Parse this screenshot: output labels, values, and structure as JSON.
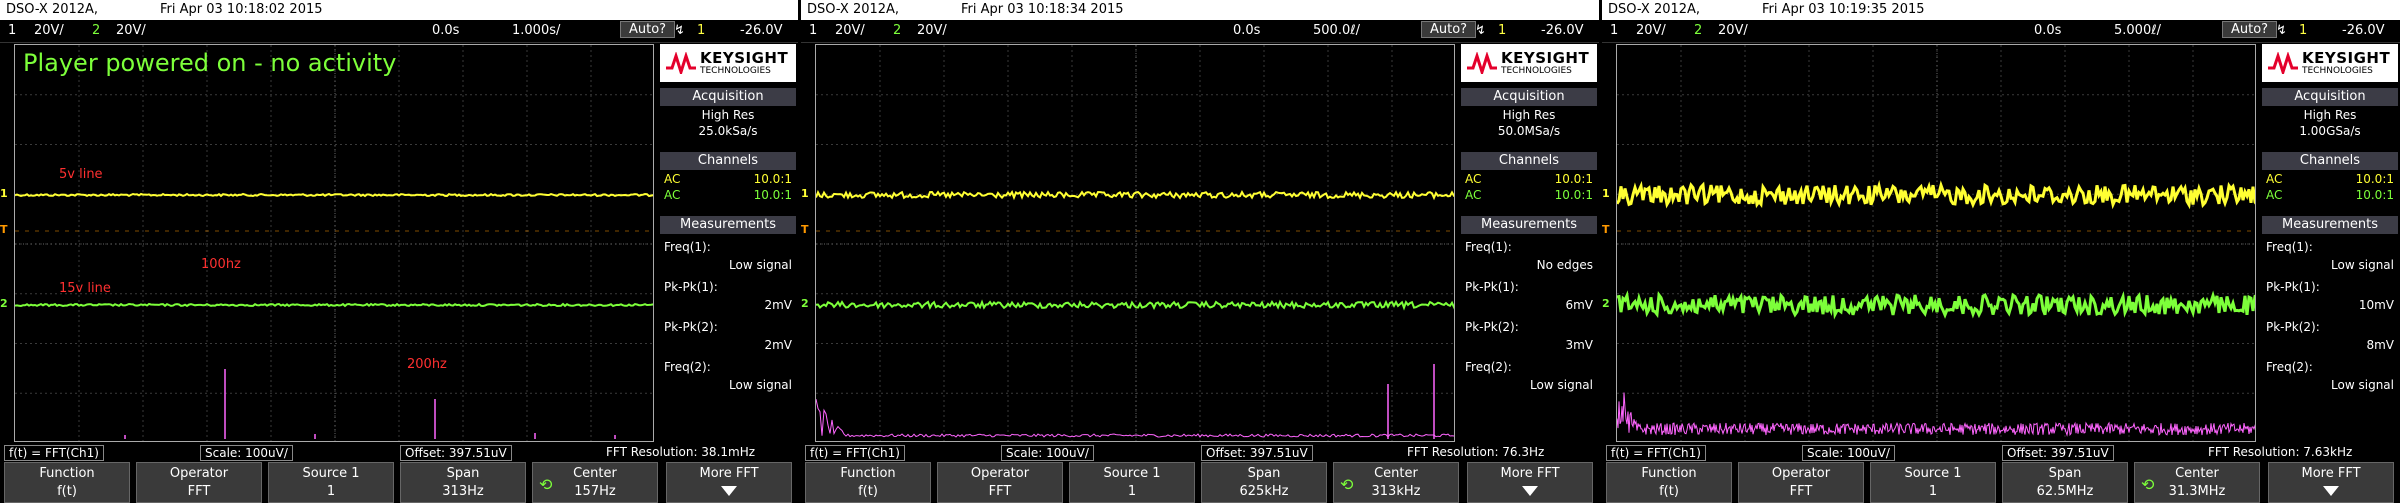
{
  "colors": {
    "ch1": "#ffff33",
    "ch2": "#7dff3a",
    "math": "#ff66ff",
    "annot": "#ff3030"
  },
  "labels": {
    "ch1": "1",
    "ch2": "2",
    "trig": "T",
    "trig_icon": "↯",
    "knob_icon": "⟲"
  },
  "scopes": [
    {
      "model": "DSO-X 2012A,",
      "datetime": "Fri Apr 03 10:18:02 2015",
      "ch1_num": "1",
      "ch1_scale": "20V/",
      "ch2_num": "2",
      "ch2_scale": "20V/",
      "delay": "0.0s",
      "timebase": "1.000s/",
      "trig_mode": "Auto?",
      "trig_ch": "1",
      "trig_level": "-26.0V",
      "title_annotation": "Player powered on - no activity",
      "annot_5v": "5v line",
      "annot_15v": "15v line",
      "annot_100hz": "100hz",
      "annot_200hz": "200hz",
      "logo": "KEYSIGHT",
      "logo_sub": "TECHNOLOGIES",
      "acq_head": "Acquisition",
      "acq_mode": "High Res",
      "acq_rate": "25.0kSa/s",
      "chan_head": "Channels",
      "ch1_coupling": "AC",
      "ch1_probe": "10.0:1",
      "ch2_coupling": "AC",
      "ch2_probe": "10.0:1",
      "meas_head": "Measurements",
      "measurements": [
        {
          "label": "Freq(1):",
          "value": "Low signal"
        },
        {
          "label": "Pk-Pk(1):",
          "value": "2mV"
        },
        {
          "label": "Pk-Pk(2):",
          "value": "2mV"
        },
        {
          "label": "Freq(2):",
          "value": "Low signal"
        }
      ],
      "fft_func": "f(t) = FFT(Ch1)",
      "fft_scale": "Scale: 100uV/",
      "fft_offset": "Offset: 397.51uV",
      "fft_res": "FFT Resolution: 38.1mHz",
      "softkeys": [
        {
          "title": "Function",
          "value": "f(t)"
        },
        {
          "title": "Operator",
          "value": "FFT"
        },
        {
          "title": "Source 1",
          "value": "1"
        },
        {
          "title": "Span",
          "value": "313Hz"
        },
        {
          "title": "Center",
          "value": "157Hz"
        },
        {
          "title": "More FFT",
          "value": ""
        }
      ],
      "trace_style": "clean"
    },
    {
      "model": "DSO-X 2012A,",
      "datetime": "Fri Apr 03 10:18:34 2015",
      "ch1_num": "1",
      "ch1_scale": "20V/",
      "ch2_num": "2",
      "ch2_scale": "20V/",
      "delay": "0.0s",
      "timebase": "500.0ℓ/",
      "trig_mode": "Auto?",
      "trig_ch": "1",
      "trig_level": "-26.0V",
      "title_annotation": "",
      "annot_5v": "",
      "annot_15v": "",
      "annot_100hz": "",
      "annot_200hz": "",
      "logo": "KEYSIGHT",
      "logo_sub": "TECHNOLOGIES",
      "acq_head": "Acquisition",
      "acq_mode": "High Res",
      "acq_rate": "50.0MSa/s",
      "chan_head": "Channels",
      "ch1_coupling": "AC",
      "ch1_probe": "10.0:1",
      "ch2_coupling": "AC",
      "ch2_probe": "10.0:1",
      "meas_head": "Measurements",
      "measurements": [
        {
          "label": "Freq(1):",
          "value": "No edges"
        },
        {
          "label": "Pk-Pk(1):",
          "value": "6mV"
        },
        {
          "label": "Pk-Pk(2):",
          "value": "3mV"
        },
        {
          "label": "Freq(2):",
          "value": "Low signal"
        }
      ],
      "fft_func": "f(t) = FFT(Ch1)",
      "fft_scale": "Scale: 100uV/",
      "fft_offset": "Offset: 397.51uV",
      "fft_res": "FFT Resolution: 76.3Hz",
      "softkeys": [
        {
          "title": "Function",
          "value": "f(t)"
        },
        {
          "title": "Operator",
          "value": "FFT"
        },
        {
          "title": "Source 1",
          "value": "1"
        },
        {
          "title": "Span",
          "value": "625kHz"
        },
        {
          "title": "Center",
          "value": "313kHz"
        },
        {
          "title": "More FFT",
          "value": ""
        }
      ],
      "trace_style": "medium"
    },
    {
      "model": "DSO-X 2012A,",
      "datetime": "Fri Apr 03 10:19:35 2015",
      "ch1_num": "1",
      "ch1_scale": "20V/",
      "ch2_num": "2",
      "ch2_scale": "20V/",
      "delay": "0.0s",
      "timebase": "5.000ℓ/",
      "trig_mode": "Auto?",
      "trig_ch": "1",
      "trig_level": "-26.0V",
      "title_annotation": "",
      "annot_5v": "",
      "annot_15v": "",
      "annot_100hz": "",
      "annot_200hz": "",
      "logo": "KEYSIGHT",
      "logo_sub": "TECHNOLOGIES",
      "acq_head": "Acquisition",
      "acq_mode": "High Res",
      "acq_rate": "1.00GSa/s",
      "chan_head": "Channels",
      "ch1_coupling": "AC",
      "ch1_probe": "10.0:1",
      "ch2_coupling": "AC",
      "ch2_probe": "10.0:1",
      "meas_head": "Measurements",
      "measurements": [
        {
          "label": "Freq(1):",
          "value": "Low signal"
        },
        {
          "label": "Pk-Pk(1):",
          "value": "10mV"
        },
        {
          "label": "Pk-Pk(2):",
          "value": "8mV"
        },
        {
          "label": "Freq(2):",
          "value": "Low signal"
        }
      ],
      "fft_func": "f(t) = FFT(Ch1)",
      "fft_scale": "Scale: 100uV/",
      "fft_offset": "Offset: 397.51uV",
      "fft_res": "FFT Resolution: 7.63kHz",
      "softkeys": [
        {
          "title": "Function",
          "value": "f(t)"
        },
        {
          "title": "Operator",
          "value": "FFT"
        },
        {
          "title": "Source 1",
          "value": "1"
        },
        {
          "title": "Span",
          "value": "62.5MHz"
        },
        {
          "title": "Center",
          "value": "31.3MHz"
        },
        {
          "title": "More FFT",
          "value": ""
        }
      ],
      "trace_style": "noisy"
    }
  ]
}
